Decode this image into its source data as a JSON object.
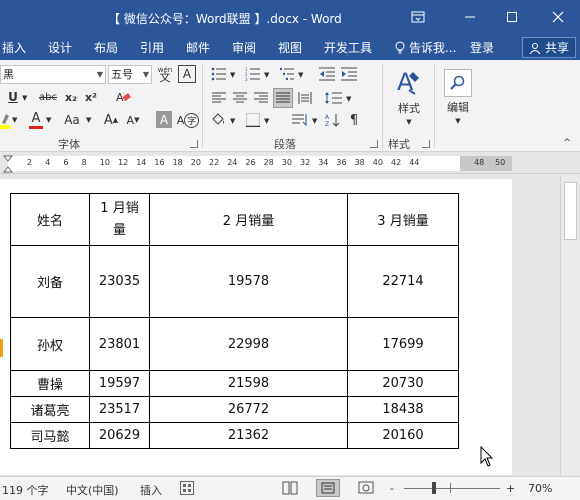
{
  "window": {
    "title": "【 微信公众号：Word联盟 】.docx - Word",
    "ribbon_display_icon": "ribbon-display-icon",
    "minimize_icon": "minimize-icon",
    "maximize_icon": "maximize-icon",
    "close_icon": "close-icon"
  },
  "tabs": [
    {
      "label": "插入"
    },
    {
      "label": "设计"
    },
    {
      "label": "布局"
    },
    {
      "label": "引用"
    },
    {
      "label": "邮件"
    },
    {
      "label": "审阅"
    },
    {
      "label": "视图"
    },
    {
      "label": "开发工具"
    }
  ],
  "tellme": "告诉我...",
  "login": "登录",
  "share": "共享",
  "ribbon": {
    "font_name": "黑",
    "font_size": "五号",
    "wen_label": "wén",
    "A_label": "A",
    "underline": "U",
    "strike": "abc",
    "sub": "x₂",
    "sup": "x²",
    "font_color_label": "A",
    "aa_label": "Aa",
    "grow_label": "A",
    "shrink_label": "A",
    "shade_label": "A",
    "char_label": "字",
    "font_group": "字体",
    "para_group": "段落",
    "style_label": "样式",
    "edit_label": "编辑",
    "style_group": "样式"
  },
  "ruler_ticks": [
    "2",
    "4",
    "6",
    "8",
    "10",
    "12",
    "14",
    "16",
    "18",
    "20",
    "22",
    "24",
    "26",
    "28",
    "30",
    "32",
    "34",
    "36",
    "38",
    "40",
    "42",
    "44",
    "48",
    "50"
  ],
  "table": {
    "headers": [
      "姓名",
      "1 月销量",
      "2 月销量",
      "3 月销量"
    ],
    "rows": [
      [
        "刘备",
        "23035",
        "19578",
        "22714"
      ],
      [
        "孙权",
        "23801",
        "22998",
        "17699"
      ],
      [
        "曹操",
        "19597",
        "21598",
        "20730"
      ],
      [
        "诸葛亮",
        "23517",
        "26772",
        "18438"
      ],
      [
        "司马懿",
        "20629",
        "21362",
        "20160"
      ]
    ]
  },
  "status": {
    "word_count": "119 个字",
    "language": "中文(中国)",
    "mode": "插入",
    "zoom_minus": "-",
    "zoom_plus": "+",
    "zoom": "70%"
  }
}
